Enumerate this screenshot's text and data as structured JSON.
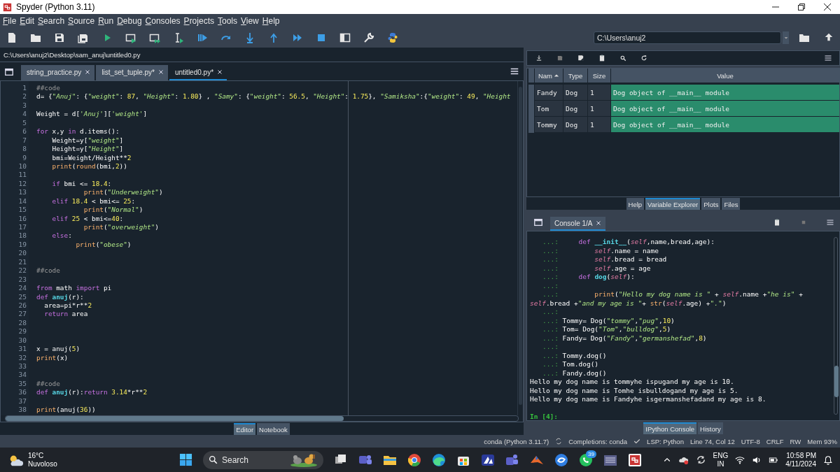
{
  "window": {
    "title": "Spyder (Python 3.11)"
  },
  "menu": [
    "File",
    "Edit",
    "Search",
    "Source",
    "Run",
    "Debug",
    "Consoles",
    "Projects",
    "Tools",
    "View",
    "Help"
  ],
  "working_directory": "C:\\Users\\anuj2",
  "editor": {
    "file_path": "C:\\Users\\anuj2\\Desktop\\sam_anuj\\untitled0.py",
    "tabs": [
      {
        "label": "string_practice.py",
        "selected": false
      },
      {
        "label": "list_set_tuple.py*",
        "selected": false
      },
      {
        "label": "untitled0.py*",
        "selected": true
      }
    ],
    "lines": [
      {
        "number": "1",
        "tokens": [
          {
            "kind": "comment",
            "text": "##code"
          }
        ]
      },
      {
        "number": "2",
        "tokens": [
          {
            "kind": "plain",
            "text": "d= {"
          },
          {
            "kind": "string",
            "text": "\"Anuj\""
          },
          {
            "kind": "plain",
            "text": ": {"
          },
          {
            "kind": "string",
            "text": "\"weight\""
          },
          {
            "kind": "plain",
            "text": ": "
          },
          {
            "kind": "number",
            "text": "87"
          },
          {
            "kind": "plain",
            "text": ", "
          },
          {
            "kind": "string",
            "text": "\"Height\""
          },
          {
            "kind": "plain",
            "text": ": "
          },
          {
            "kind": "number",
            "text": "1.80"
          },
          {
            "kind": "plain",
            "text": "} , "
          },
          {
            "kind": "string",
            "text": "\"Samy\""
          },
          {
            "kind": "plain",
            "text": ": {"
          },
          {
            "kind": "string",
            "text": "\"weight\""
          },
          {
            "kind": "plain",
            "text": ": "
          },
          {
            "kind": "number",
            "text": "56.5"
          },
          {
            "kind": "plain",
            "text": ", "
          },
          {
            "kind": "string",
            "text": "\"Height\""
          },
          {
            "kind": "plain",
            "text": ": "
          },
          {
            "kind": "number",
            "text": "1.75"
          },
          {
            "kind": "plain",
            "text": "}, "
          },
          {
            "kind": "string",
            "text": "\"Samiksha\""
          },
          {
            "kind": "plain",
            "text": ":{"
          },
          {
            "kind": "string",
            "text": "\"weight\""
          },
          {
            "kind": "plain",
            "text": ": "
          },
          {
            "kind": "number",
            "text": "49"
          },
          {
            "kind": "plain",
            "text": ", "
          },
          {
            "kind": "string",
            "text": "\"Height"
          }
        ]
      },
      {
        "number": "3"
      },
      {
        "number": "4",
        "tokens": [
          {
            "kind": "plain",
            "text": "Weight = d["
          },
          {
            "kind": "string",
            "text": "'Anuj'"
          },
          {
            "kind": "plain",
            "text": "]["
          },
          {
            "kind": "string",
            "text": "'weight'"
          },
          {
            "kind": "plain",
            "text": "]"
          }
        ]
      },
      {
        "number": "5"
      },
      {
        "number": "6",
        "tokens": [
          {
            "kind": "keyword",
            "text": "for"
          },
          {
            "kind": "plain",
            "text": " x,y "
          },
          {
            "kind": "keyword",
            "text": "in"
          },
          {
            "kind": "plain",
            "text": " d.items():"
          }
        ]
      },
      {
        "number": "7",
        "tokens": [
          {
            "kind": "plain",
            "text": "    Weight=y["
          },
          {
            "kind": "string",
            "text": "\"weight\""
          },
          {
            "kind": "plain",
            "text": "]"
          }
        ]
      },
      {
        "number": "8",
        "tokens": [
          {
            "kind": "plain",
            "text": "    Height=y["
          },
          {
            "kind": "string",
            "text": "\"Height\""
          },
          {
            "kind": "plain",
            "text": "]"
          }
        ]
      },
      {
        "number": "9",
        "tokens": [
          {
            "kind": "plain",
            "text": "    bmi=Weight/Height**"
          },
          {
            "kind": "number",
            "text": "2"
          }
        ]
      },
      {
        "number": "10",
        "tokens": [
          {
            "kind": "builtin",
            "text": "    print"
          },
          {
            "kind": "plain",
            "text": "("
          },
          {
            "kind": "builtin",
            "text": "round"
          },
          {
            "kind": "plain",
            "text": "(bmi,"
          },
          {
            "kind": "number",
            "text": "2"
          },
          {
            "kind": "plain",
            "text": "))"
          }
        ]
      },
      {
        "number": "11"
      },
      {
        "number": "12",
        "tokens": [
          {
            "kind": "keyword",
            "text": "    if"
          },
          {
            "kind": "plain",
            "text": " bmi <= "
          },
          {
            "kind": "number",
            "text": "18.4"
          },
          {
            "kind": "plain",
            "text": ":"
          }
        ]
      },
      {
        "number": "13",
        "tokens": [
          {
            "kind": "builtin",
            "text": "            print"
          },
          {
            "kind": "plain",
            "text": "("
          },
          {
            "kind": "string",
            "text": "\"Underweight\""
          },
          {
            "kind": "plain",
            "text": ")"
          }
        ]
      },
      {
        "number": "14",
        "tokens": [
          {
            "kind": "keyword",
            "text": "    elif"
          },
          {
            "kind": "number",
            "text": " 18.4"
          },
          {
            "kind": "plain",
            "text": " < bmi<= "
          },
          {
            "kind": "number",
            "text": "25"
          },
          {
            "kind": "plain",
            "text": ":"
          }
        ]
      },
      {
        "number": "15",
        "tokens": [
          {
            "kind": "builtin",
            "text": "            print"
          },
          {
            "kind": "plain",
            "text": "("
          },
          {
            "kind": "string",
            "text": "\"Normal\""
          },
          {
            "kind": "plain",
            "text": ")"
          }
        ]
      },
      {
        "number": "16",
        "tokens": [
          {
            "kind": "keyword",
            "text": "    elif"
          },
          {
            "kind": "number",
            "text": " 25"
          },
          {
            "kind": "plain",
            "text": " < bmi<="
          },
          {
            "kind": "number",
            "text": "40"
          },
          {
            "kind": "plain",
            "text": ":"
          }
        ]
      },
      {
        "number": "17",
        "tokens": [
          {
            "kind": "builtin",
            "text": "            print"
          },
          {
            "kind": "plain",
            "text": "("
          },
          {
            "kind": "string",
            "text": "\"overweight\""
          },
          {
            "kind": "plain",
            "text": ")"
          }
        ]
      },
      {
        "number": "18",
        "tokens": [
          {
            "kind": "keyword",
            "text": "    else"
          },
          {
            "kind": "plain",
            "text": ":"
          }
        ]
      },
      {
        "number": "19",
        "tokens": [
          {
            "kind": "builtin",
            "text": "          print"
          },
          {
            "kind": "plain",
            "text": "("
          },
          {
            "kind": "string",
            "text": "\"obese\""
          },
          {
            "kind": "plain",
            "text": ")"
          }
        ]
      },
      {
        "number": "20"
      },
      {
        "number": "21"
      },
      {
        "number": "22",
        "tokens": [
          {
            "kind": "comment",
            "text": "##code"
          }
        ]
      },
      {
        "number": "23"
      },
      {
        "number": "24",
        "tokens": [
          {
            "kind": "keyword",
            "text": "from"
          },
          {
            "kind": "plain",
            "text": " math "
          },
          {
            "kind": "keyword",
            "text": "import"
          },
          {
            "kind": "plain",
            "text": " pi"
          }
        ]
      },
      {
        "number": "25",
        "tokens": [
          {
            "kind": "keyword",
            "text": "def"
          },
          {
            "kind": "function",
            "text": " anuj"
          },
          {
            "kind": "plain",
            "text": "(r):"
          }
        ]
      },
      {
        "number": "26",
        "tokens": [
          {
            "kind": "plain",
            "text": "  area=pi*r**"
          },
          {
            "kind": "number",
            "text": "2"
          }
        ]
      },
      {
        "number": "27",
        "tokens": [
          {
            "kind": "keyword",
            "text": "  return"
          },
          {
            "kind": "plain",
            "text": " area"
          }
        ]
      },
      {
        "number": "28"
      },
      {
        "number": "29"
      },
      {
        "number": "30"
      },
      {
        "number": "31",
        "tokens": [
          {
            "kind": "plain",
            "text": "x = anuj("
          },
          {
            "kind": "number",
            "text": "5"
          },
          {
            "kind": "plain",
            "text": ")"
          }
        ]
      },
      {
        "number": "32",
        "tokens": [
          {
            "kind": "builtin",
            "text": "print"
          },
          {
            "kind": "plain",
            "text": "(x)"
          }
        ]
      },
      {
        "number": "33"
      },
      {
        "number": "34"
      },
      {
        "number": "35",
        "tokens": [
          {
            "kind": "comment",
            "text": "##code"
          }
        ]
      },
      {
        "number": "36",
        "tokens": [
          {
            "kind": "keyword",
            "text": "def"
          },
          {
            "kind": "function",
            "text": " anuj"
          },
          {
            "kind": "plain",
            "text": "(r):"
          },
          {
            "kind": "keyword",
            "text": "return"
          },
          {
            "kind": "number",
            "text": " 3.14"
          },
          {
            "kind": "plain",
            "text": "*r**"
          },
          {
            "kind": "number",
            "text": "2"
          }
        ]
      },
      {
        "number": "37"
      },
      {
        "number": "38",
        "tokens": [
          {
            "kind": "builtin",
            "text": "print"
          },
          {
            "kind": "plain",
            "text": "(anuj("
          },
          {
            "kind": "number",
            "text": "36"
          },
          {
            "kind": "plain",
            "text": "))"
          }
        ]
      }
    ],
    "bottom_tabs": [
      {
        "label": "Editor",
        "selected": true
      },
      {
        "label": "Notebook",
        "selected": false
      }
    ]
  },
  "variable_explorer": {
    "columns": [
      "Nam",
      "Type",
      "Size",
      "Value"
    ],
    "rows": [
      {
        "name": "Fandy",
        "type": "Dog",
        "size": "1",
        "value": "Dog object of __main__ module"
      },
      {
        "name": "Tom",
        "type": "Dog",
        "size": "1",
        "value": "Dog object of __main__ module"
      },
      {
        "name": "Tommy",
        "type": "Dog",
        "size": "1",
        "value": "Dog object of __main__ module"
      }
    ],
    "tabs": [
      {
        "label": "Help",
        "selected": false
      },
      {
        "label": "Variable Explorer",
        "selected": true
      },
      {
        "label": "Plots",
        "selected": false
      },
      {
        "label": "Files",
        "selected": false
      }
    ]
  },
  "console": {
    "tabs": [
      {
        "label": "Console 1/A",
        "selected": true
      }
    ],
    "lines": [
      {
        "kind": "continuation",
        "prompt": "...:",
        "tokens": [
          {
            "kind": "keyword",
            "text": "     def"
          },
          {
            "kind": "function",
            "text": " __init__"
          },
          {
            "kind": "plain",
            "text": "("
          },
          {
            "kind": "self",
            "text": "self"
          },
          {
            "kind": "plain",
            "text": ",name,bread,age):"
          }
        ]
      },
      {
        "kind": "continuation",
        "prompt": "...:",
        "tokens": [
          {
            "kind": "self",
            "text": "         self"
          },
          {
            "kind": "plain",
            "text": ".name = name"
          }
        ]
      },
      {
        "kind": "continuation",
        "prompt": "...:",
        "tokens": [
          {
            "kind": "self",
            "text": "         self"
          },
          {
            "kind": "plain",
            "text": ".bread = bread"
          }
        ]
      },
      {
        "kind": "continuation",
        "prompt": "...:",
        "tokens": [
          {
            "kind": "self",
            "text": "         self"
          },
          {
            "kind": "plain",
            "text": ".age = age"
          }
        ]
      },
      {
        "kind": "continuation",
        "prompt": "...:",
        "tokens": [
          {
            "kind": "keyword",
            "text": "     def"
          },
          {
            "kind": "function",
            "text": " dog"
          },
          {
            "kind": "plain",
            "text": "("
          },
          {
            "kind": "self",
            "text": "self"
          },
          {
            "kind": "plain",
            "text": "):"
          }
        ]
      },
      {
        "kind": "continuation",
        "prompt": "...:"
      },
      {
        "kind": "continuation",
        "prompt": "...:",
        "tokens": [
          {
            "kind": "builtin",
            "text": "         print"
          },
          {
            "kind": "plain",
            "text": "("
          },
          {
            "kind": "string",
            "text": "\"Hello my dog name is \""
          },
          {
            "kind": "plain",
            "text": " + "
          },
          {
            "kind": "self",
            "text": "self"
          },
          {
            "kind": "plain",
            "text": ".name +"
          },
          {
            "kind": "string",
            "text": "\"he is\""
          },
          {
            "kind": "plain",
            "text": " +"
          }
        ]
      },
      {
        "kind": "wrapped",
        "tokens": [
          {
            "kind": "self",
            "text": "self"
          },
          {
            "kind": "plain",
            "text": ".bread +"
          },
          {
            "kind": "string",
            "text": "\"and my age is \""
          },
          {
            "kind": "plain",
            "text": "+ "
          },
          {
            "kind": "builtin",
            "text": "str"
          },
          {
            "kind": "plain",
            "text": "("
          },
          {
            "kind": "self",
            "text": "self"
          },
          {
            "kind": "plain",
            "text": ".age) +"
          },
          {
            "kind": "string",
            "text": "\".\""
          },
          {
            "kind": "plain",
            "text": ")"
          }
        ]
      },
      {
        "kind": "continuation",
        "prompt": "...:"
      },
      {
        "kind": "continuation",
        "prompt": "...:",
        "tokens": [
          {
            "kind": "plain",
            "text": " Tommy= Dog("
          },
          {
            "kind": "string",
            "text": "\"tommy\""
          },
          {
            "kind": "plain",
            "text": ","
          },
          {
            "kind": "string",
            "text": "\"pug\""
          },
          {
            "kind": "plain",
            "text": ","
          },
          {
            "kind": "number",
            "text": "10"
          },
          {
            "kind": "plain",
            "text": ")"
          }
        ]
      },
      {
        "kind": "continuation",
        "prompt": "...:",
        "tokens": [
          {
            "kind": "plain",
            "text": " Tom= Dog("
          },
          {
            "kind": "string",
            "text": "\"Tom\""
          },
          {
            "kind": "plain",
            "text": ","
          },
          {
            "kind": "string",
            "text": "\"bulldog\""
          },
          {
            "kind": "plain",
            "text": ","
          },
          {
            "kind": "number",
            "text": "5"
          },
          {
            "kind": "plain",
            "text": ")"
          }
        ]
      },
      {
        "kind": "continuation",
        "prompt": "...:",
        "tokens": [
          {
            "kind": "plain",
            "text": " Fandy= Dog("
          },
          {
            "kind": "string",
            "text": "\"Fandy\""
          },
          {
            "kind": "plain",
            "text": ","
          },
          {
            "kind": "string",
            "text": "\"germanshefad\""
          },
          {
            "kind": "plain",
            "text": ","
          },
          {
            "kind": "number",
            "text": "8"
          },
          {
            "kind": "plain",
            "text": ")"
          }
        ]
      },
      {
        "kind": "continuation",
        "prompt": "...:"
      },
      {
        "kind": "continuation",
        "prompt": "...:",
        "tokens": [
          {
            "kind": "plain",
            "text": " Tommy.dog()"
          }
        ]
      },
      {
        "kind": "continuation",
        "prompt": "...:",
        "tokens": [
          {
            "kind": "plain",
            "text": " Tom.dog()"
          }
        ]
      },
      {
        "kind": "continuation",
        "prompt": "...:",
        "tokens": [
          {
            "kind": "plain",
            "text": " Fandy.dog()"
          }
        ]
      },
      {
        "kind": "output",
        "text": "Hello my dog name is tommyhe ispugand my age is 10."
      },
      {
        "kind": "output",
        "text": "Hello my dog name is Tomhe isbulldogand my age is 5."
      },
      {
        "kind": "output",
        "text": "Hello my dog name is Fandyhe isgermanshefadand my age is 8."
      },
      {
        "kind": "blank"
      },
      {
        "kind": "input",
        "prompt": "In [4]:"
      }
    ],
    "bottom_tabs": [
      {
        "label": "IPython Console",
        "selected": true
      },
      {
        "label": "History",
        "selected": false
      }
    ]
  },
  "status_bar": [
    "conda (Python 3.11.7)",
    "Completions: conda",
    "LSP: Python",
    "Line 74, Col 12",
    "UTF-8",
    "CRLF",
    "RW",
    "Mem 93%"
  ],
  "taskbar": {
    "temperature": "16°C",
    "condition": "Nuvoloso",
    "search_placeholder": "Search",
    "chat_badge": "39",
    "language": "ENG",
    "region": "IN",
    "time": "10:58 PM",
    "date": "4/11/2024"
  }
}
